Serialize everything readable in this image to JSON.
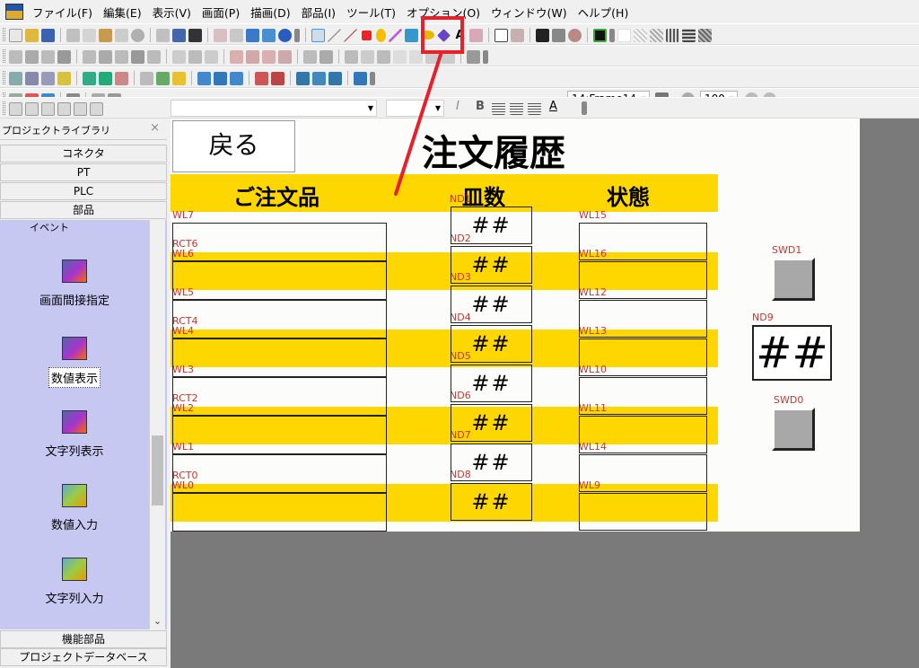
{
  "menubar": {
    "items": [
      "ファイル(F)",
      "編集(E)",
      "表示(V)",
      "画面(P)",
      "描画(D)",
      "部品(I)",
      "ツール(T)",
      "オプション(O)",
      "ウィンドウ(W)",
      "ヘルプ(H)"
    ]
  },
  "toolbar": {
    "frame_select": "14:Frame14",
    "zoom": "100"
  },
  "library": {
    "title": "プロジェクトライブラリ",
    "tabs": [
      "コネクタ",
      "PT",
      "PLC",
      "部品"
    ],
    "category": "イベント",
    "parts": [
      {
        "label": "画面間接指定",
        "icon": "indirect-screen-icon"
      },
      {
        "label": "数値表示",
        "icon": "numeric-display-icon"
      },
      {
        "label": "文字列表示",
        "icon": "string-display-icon"
      },
      {
        "label": "数値入力",
        "icon": "numeric-input-icon"
      },
      {
        "label": "文字列入力",
        "icon": "string-input-icon"
      }
    ],
    "bottom_tabs": [
      "機能部品",
      "プロジェクトデータベース"
    ]
  },
  "screen": {
    "back_button": "戻る",
    "title": "注文履歴",
    "columns": [
      "ご注文品",
      "皿数",
      "状態"
    ],
    "placeholder": "##",
    "rows": [
      {
        "wl": "WL7",
        "rct": "RCT6",
        "nd": "ND1",
        "status": "WL15"
      },
      {
        "wl": "WL6",
        "rct": "",
        "nd": "ND2",
        "status": "WL16"
      },
      {
        "wl": "WL5",
        "rct": "RCT4",
        "nd": "ND3",
        "status": "WL12"
      },
      {
        "wl": "WL4",
        "rct": "",
        "nd": "ND4",
        "status": "WL13"
      },
      {
        "wl": "WL3",
        "rct": "RCT2",
        "nd": "ND5",
        "status": "WL10"
      },
      {
        "wl": "WL2",
        "rct": "",
        "nd": "ND6",
        "status": "WL11"
      },
      {
        "wl": "WL1",
        "rct": "RCT0",
        "nd": "ND7",
        "status": "WL14"
      },
      {
        "wl": "WL0",
        "rct": "",
        "nd": "ND8",
        "status": "WL9"
      }
    ],
    "switch_top": "SWD1",
    "total_label": "ND9",
    "total_value": "##",
    "switch_bottom": "SWD0"
  },
  "colors": {
    "stripe": "#ffd700",
    "tag_text": "#cc3333",
    "highlight": "#e8202a",
    "panel_bg": "#c6c8f2",
    "workspace": "#7a7a7a"
  }
}
